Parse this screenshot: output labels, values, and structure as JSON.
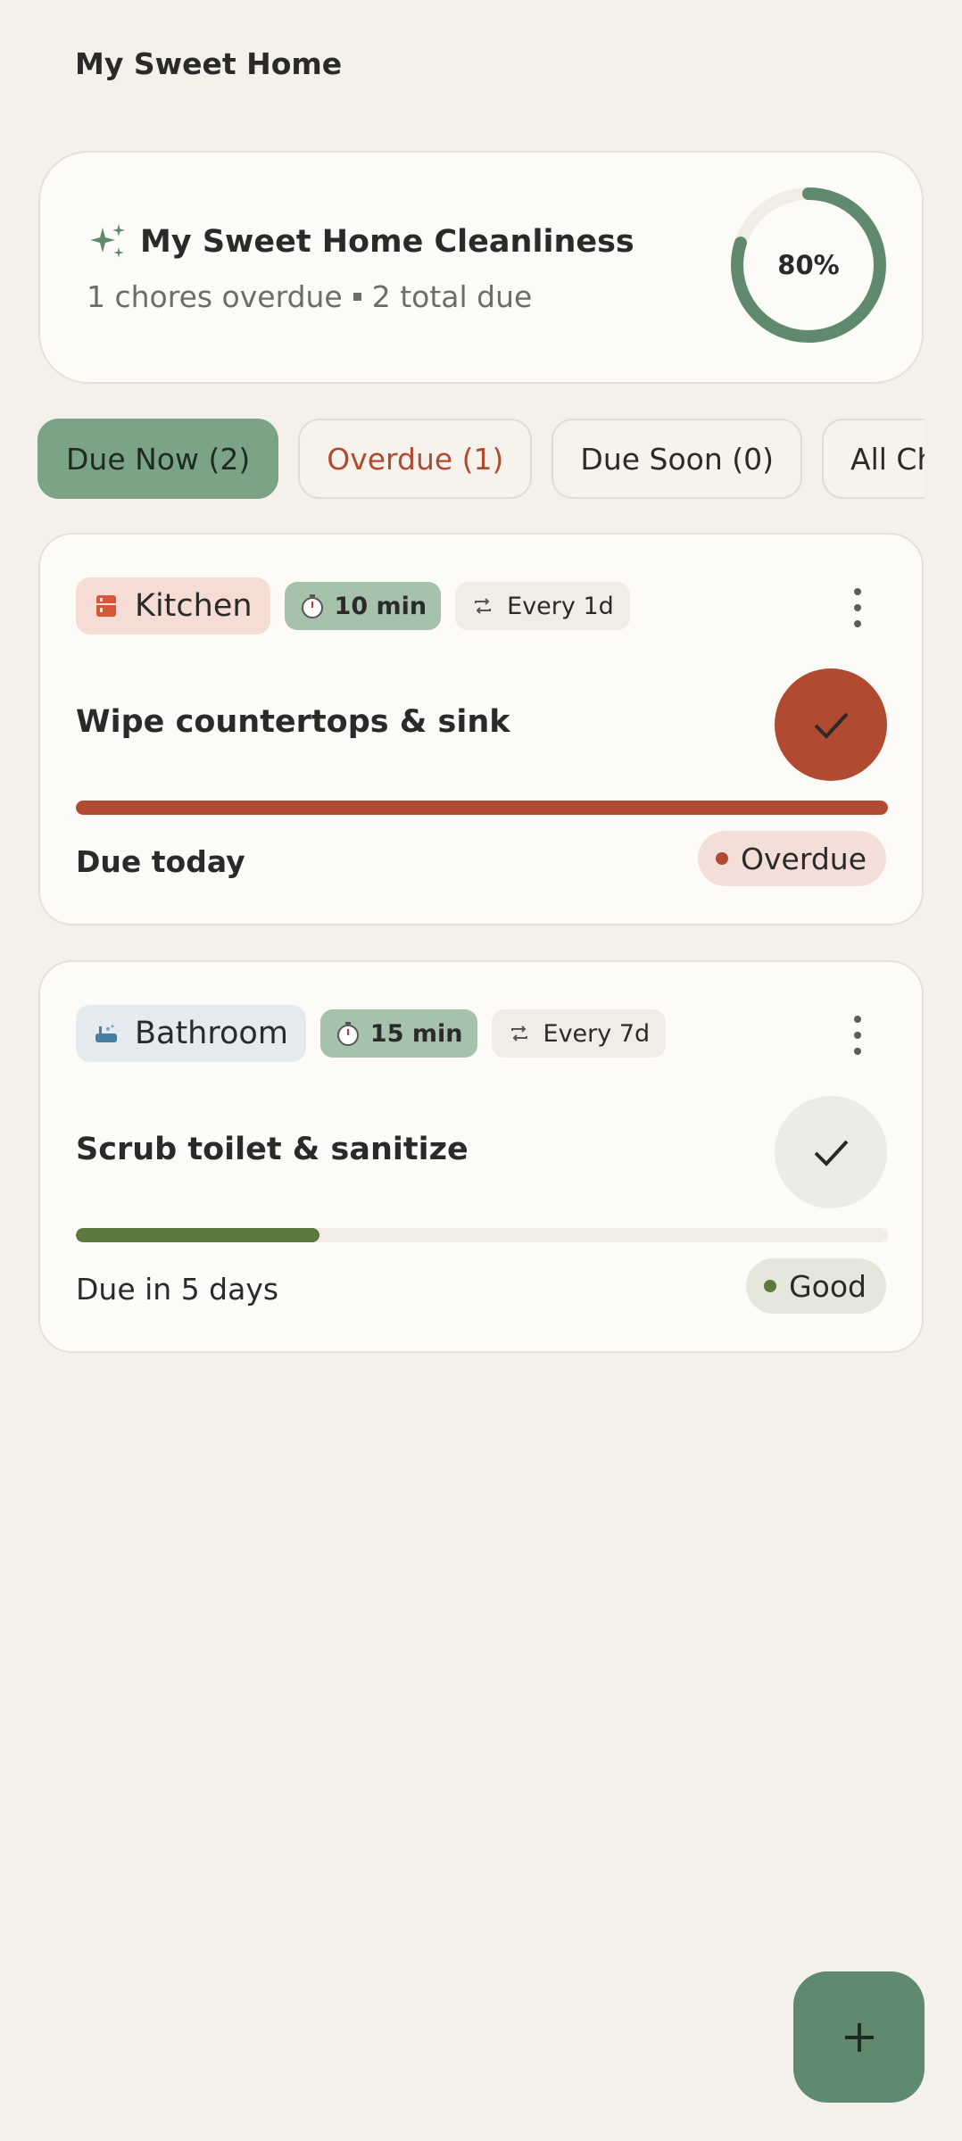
{
  "app": {
    "title": "My Sweet Home"
  },
  "summary": {
    "title": "My Sweet Home Cleanliness",
    "overdue_text": "1 chores overdue",
    "due_text": "2 total due",
    "cleanliness_percent": 80,
    "cleanliness_label": "80%",
    "icon": "sparkle-icon"
  },
  "tabs": [
    {
      "label": "Due Now (2)",
      "active": true
    },
    {
      "label": "Overdue (1)",
      "active": false
    },
    {
      "label": "Due Soon (0)",
      "active": false
    },
    {
      "label": "All Chores",
      "active": false
    }
  ],
  "chores": [
    {
      "room": "Kitchen",
      "room_icon": "kitchen-icon",
      "duration": "10 min",
      "frequency": "Every 1d",
      "name": "Wipe countertops & sink",
      "progress": 1.0,
      "due": "Due today",
      "status": "Overdue",
      "colors": {
        "room_bg": "#f5ddd6",
        "accent": "#b04a30",
        "badge_bg": "#f3dfd8",
        "check_bg": "#b04a30"
      }
    },
    {
      "room": "Bathroom",
      "room_icon": "bathtub-icon",
      "duration": "15 min",
      "frequency": "Every 7d",
      "name": "Scrub toilet & sanitize",
      "progress": 0.3,
      "due": "Due in 5 days",
      "status": "Good",
      "colors": {
        "room_bg": "#e4eaee",
        "accent": "#5d7a3e",
        "badge_bg": "#e6e6dc",
        "check_bg": "#eaece7"
      }
    }
  ],
  "fab": {
    "icon": "plus-icon"
  },
  "colors": {
    "primary": "#5f8a6d",
    "background": "#f4f1eb",
    "surface": "#fcfbf8"
  }
}
